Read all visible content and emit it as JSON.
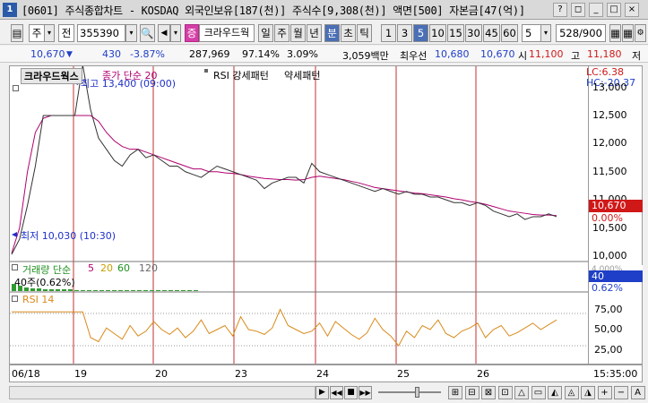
{
  "titlebar": {
    "title": "[0601] 주식종합차트 - KOSDAQ 외국인보유[187(천)] 주식수[9,308(천)] 액면[500] 자본금[47(억)]",
    "app_icon": "1",
    "buttons": [
      "?",
      "◻",
      "_",
      "□",
      "×"
    ]
  },
  "toolbar": {
    "code_type": "주",
    "spin": "전",
    "code": "355390",
    "stock_name": "크라우드웍",
    "tag": "증",
    "periods": [
      "일",
      "주",
      "월",
      "년"
    ],
    "units": [
      "분",
      "초",
      "틱"
    ],
    "minute_options": [
      "1",
      "3",
      "5",
      "10",
      "15",
      "30",
      "45",
      "60"
    ],
    "selected_minute": "5",
    "interval": "5",
    "count": "528/900",
    "tools": [
      "▦",
      "▦",
      "⚙",
      "▶"
    ]
  },
  "quote": {
    "price": "10,670",
    "change": "430",
    "change_rate": "-3.87%",
    "volume": "287,969",
    "vol_rate": "97.14%",
    "turnover_rate": "3.09%",
    "amount": "3,059백만",
    "best_ask_label": "최우선",
    "best_ask": "10,680",
    "best_bid": "10,670",
    "open_label": "시",
    "open": "11,100",
    "high_label": "고",
    "high": "11,180",
    "low_label": "저"
  },
  "chart_labels": {
    "stock": "크라우드웍스",
    "ma": "종가 단순 20",
    "rsi_pattern": "RSI 강세패턴",
    "weak": "약세패턴",
    "high_marker": "최고 13,400 (09:00)",
    "low_marker": "최저 10,030 (10:30)",
    "lc": "LC:6.38",
    "hc": "HC:-20.37",
    "cur_price": "10,670",
    "cur_pct": "0.00%",
    "vol_title": "거래량 단순",
    "vol_ma": [
      "5",
      "20",
      "60",
      "120"
    ],
    "vol_info": "40주(0.62%)",
    "vol_axis": "40",
    "vol_axis_pct": "0.62%",
    "vol_axis_top": "4,000%",
    "rsi_title": "RSI 14"
  },
  "chart_data": {
    "type": "line",
    "price_axis": {
      "ticks": [
        "13,000",
        "12,500",
        "12,000",
        "11,500",
        "11,000",
        "10,500",
        "10,000"
      ],
      "values": [
        13000,
        12500,
        12000,
        11500,
        11000,
        10500,
        10000
      ],
      "ylim": [
        9950,
        13250
      ]
    },
    "rsi_axis": {
      "ticks": [
        "75,00",
        "50,00",
        "25,00"
      ],
      "values": [
        75,
        50,
        25
      ],
      "ylim": [
        10,
        90
      ]
    },
    "dates": [
      "06/18",
      "19",
      "20",
      "23",
      "24",
      "25",
      "26"
    ],
    "time_label": "15:35:00",
    "price_series": [
      10030,
      10300,
      10900,
      11600,
      12500,
      12500,
      12500,
      12500,
      12500,
      13400,
      12600,
      12100,
      11900,
      11700,
      11600,
      11800,
      11900,
      11750,
      11800,
      11700,
      11600,
      11600,
      11500,
      11450,
      11400,
      11500,
      11600,
      11550,
      11500,
      11450,
      11400,
      11350,
      11200,
      11300,
      11350,
      11400,
      11400,
      11300,
      11650,
      11500,
      11450,
      11400,
      11350,
      11300,
      11250,
      11200,
      11150,
      11200,
      11150,
      11100,
      11150,
      11100,
      11100,
      11050,
      11050,
      11000,
      10950,
      10950,
      10900,
      10950,
      10900,
      10800,
      10750,
      10700,
      10750,
      10650,
      10700,
      10700,
      10750,
      10700
    ],
    "ma20_series": [
      10050,
      10500,
      11500,
      12200,
      12450,
      12500,
      12500,
      12500,
      12500,
      12500,
      12500,
      12400,
      12200,
      12050,
      11950,
      11900,
      11900,
      11850,
      11800,
      11750,
      11700,
      11650,
      11600,
      11550,
      11550,
      11500,
      11500,
      11480,
      11470,
      11450,
      11420,
      11400,
      11380,
      11370,
      11360,
      11360,
      11350,
      11360,
      11400,
      11420,
      11400,
      11380,
      11360,
      11330,
      11300,
      11260,
      11220,
      11200,
      11180,
      11160,
      11140,
      11120,
      11110,
      11090,
      11070,
      11050,
      11020,
      11000,
      10970,
      10950,
      10920,
      10880,
      10840,
      10800,
      10780,
      10760,
      10740,
      10730,
      10730,
      10720
    ],
    "rsi_series": [
      72,
      72,
      72,
      72,
      72,
      72,
      72,
      72,
      72,
      72,
      40,
      35,
      52,
      45,
      38,
      55,
      42,
      48,
      60,
      50,
      44,
      52,
      40,
      48,
      62,
      45,
      50,
      55,
      42,
      66,
      50,
      48,
      44,
      52,
      75,
      55,
      50,
      45,
      48,
      58,
      42,
      60,
      52,
      44,
      38,
      46,
      64,
      50,
      42,
      30,
      48,
      40,
      55,
      50,
      62,
      45,
      40,
      48,
      52,
      58,
      40,
      50,
      55,
      42,
      46,
      52,
      58,
      50,
      56,
      62
    ],
    "volume_series": [
      8,
      6,
      4,
      3,
      3,
      2,
      2,
      2,
      2,
      2,
      1,
      1,
      1,
      1,
      1,
      1,
      1,
      1,
      1,
      1,
      1,
      1,
      1,
      1,
      1,
      1,
      1,
      1,
      1,
      1
    ]
  },
  "bottombar": {
    "nav": [
      "▶",
      "◀◀",
      "■",
      "▶▶"
    ],
    "tools": [
      "⊞",
      "⊟",
      "⊠",
      "⊡",
      "△",
      "▭",
      "◭",
      "◬",
      "◮",
      "+",
      "−",
      "A"
    ]
  }
}
